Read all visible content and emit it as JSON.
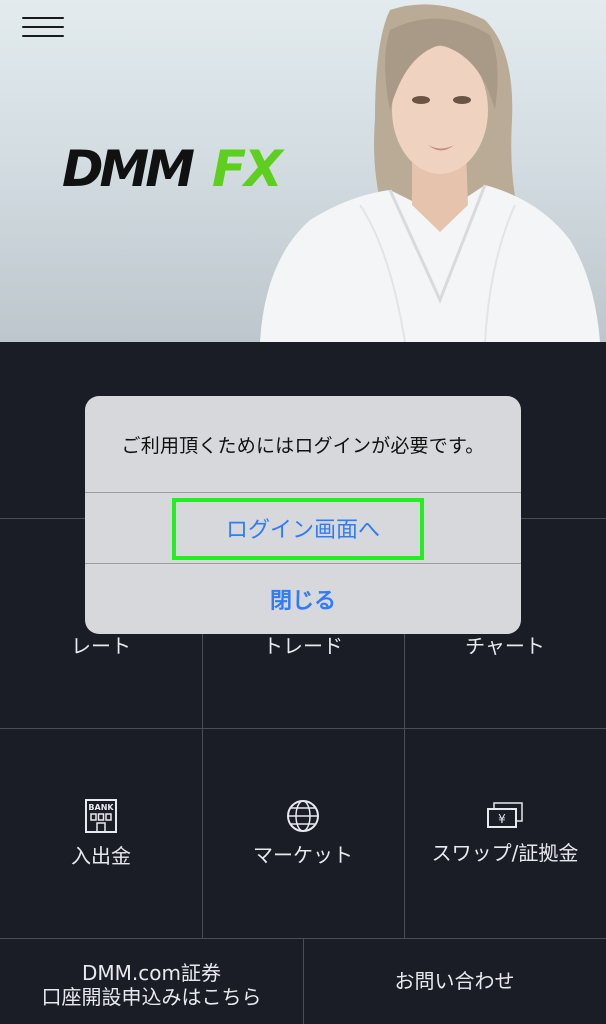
{
  "header": {
    "menu_icon": "hamburger-menu-icon",
    "logo": {
      "word1": "DMM",
      "word2": "FX",
      "word1_color": "#111111",
      "word2_color": "#5fcf1f"
    }
  },
  "grid": {
    "rate_label": "レート",
    "trade_label": "トレード",
    "chart_label": "チャート",
    "deposit_label": "入出金",
    "deposit_icon_text": "BANK",
    "market_label": "マーケット",
    "swap_label": "スワップ/証拠金",
    "swap_icon_text": "¥",
    "securities_line1": "DMM.com証券",
    "securities_line2": "口座開設申込みはこちら",
    "contact_label": "お問い合わせ"
  },
  "dialog": {
    "message": "ご利用頂くためにはログインが必要です。",
    "login_button": "ログイン画面へ",
    "close_button": "閉じる",
    "button_color": "#2f7cf6",
    "highlight_color": "#22ee22"
  }
}
